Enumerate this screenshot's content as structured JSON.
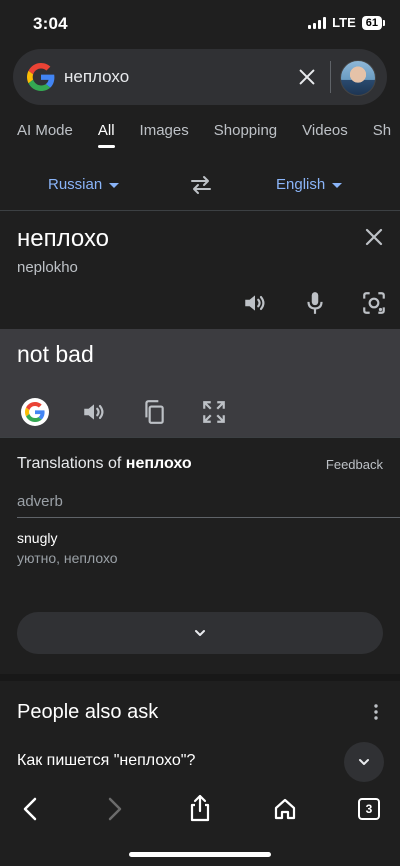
{
  "status": {
    "time": "3:04",
    "network": "LTE",
    "battery": "61"
  },
  "search": {
    "query": "неплохо"
  },
  "tabs": [
    "AI Mode",
    "All",
    "Images",
    "Shopping",
    "Videos",
    "Sh"
  ],
  "translator": {
    "source_lang": "Russian",
    "target_lang": "English",
    "source_text": "неплохо",
    "transliteration": "neplokho",
    "translation": "not bad"
  },
  "translations": {
    "title_prefix": "Translations of ",
    "title_word": "неплохо",
    "feedback": "Feedback",
    "part_of_speech": "adverb",
    "entries": [
      {
        "word": "snugly",
        "back": "уютно, неплохо"
      }
    ]
  },
  "people_also_ask": {
    "title": "People also ask",
    "questions": [
      "Как пишется \"неплохо\"?"
    ]
  },
  "browser": {
    "tab_count": "3"
  },
  "colors": {
    "accent": "#8ab4f8",
    "background": "#1f1f1f",
    "surface": "#303134",
    "panel": "#3c3c40"
  }
}
